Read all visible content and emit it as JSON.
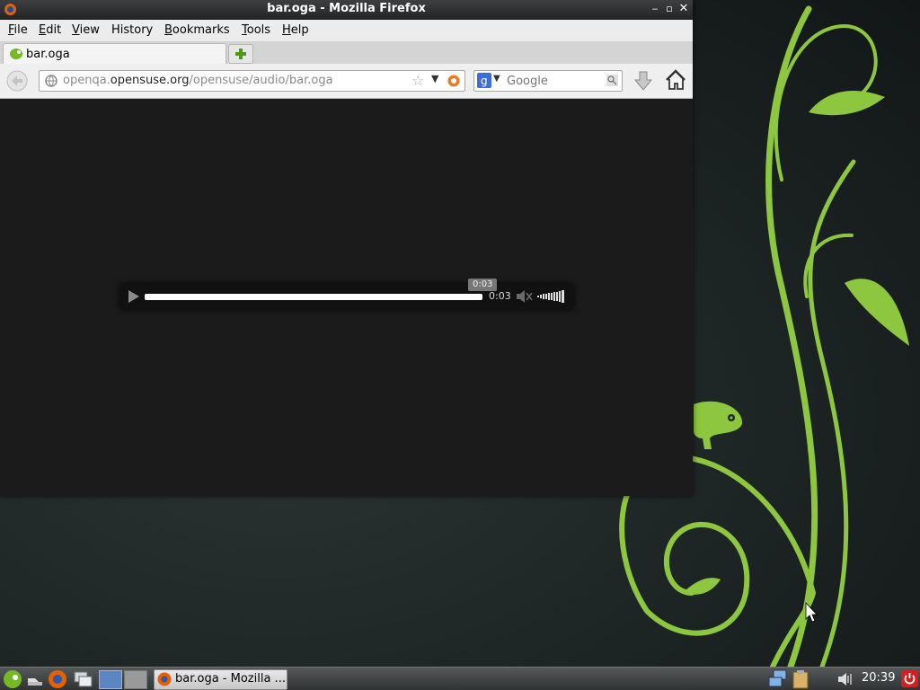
{
  "window": {
    "title": "bar.oga - Mozilla Firefox"
  },
  "menubar": {
    "items": [
      {
        "label": "File",
        "key": "F",
        "rest": "ile"
      },
      {
        "label": "Edit",
        "key": "E",
        "rest": "dit"
      },
      {
        "label": "View",
        "key": "V",
        "rest": "iew"
      },
      {
        "label": "History",
        "key": "",
        "rest": "History"
      },
      {
        "label": "Bookmarks",
        "key": "B",
        "rest": "ookmarks"
      },
      {
        "label": "Tools",
        "key": "T",
        "rest": "ools"
      },
      {
        "label": "Help",
        "key": "H",
        "rest": "elp"
      }
    ]
  },
  "tab": {
    "label": "bar.oga"
  },
  "urlbar": {
    "prefix": "openqa.",
    "domain": "opensuse.org",
    "path": "/opensuse/audio/bar.oga"
  },
  "search": {
    "placeholder": "Google"
  },
  "player": {
    "time": "0:03",
    "tooltip": "0:03",
    "progress_fraction": 1.0
  },
  "taskbar": {
    "window_button": "bar.oga - Mozilla ...",
    "clock": "20:39"
  },
  "colors": {
    "vine_green": "#8dc63f",
    "desktop_bg": "#1f2626",
    "content_bg": "#1c1b1b"
  }
}
